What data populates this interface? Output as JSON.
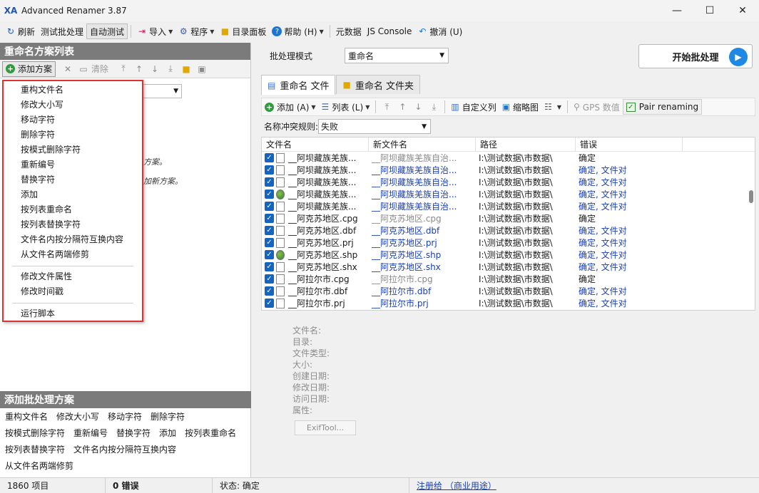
{
  "window": {
    "title": "Advanced Renamer 3.87",
    "app_icon_text": "XA"
  },
  "toolbar": {
    "refresh": "刷新",
    "test_batch": "测试批处理",
    "auto_test": "自动测试",
    "import": "导入",
    "program": "程序",
    "directory_panel": "目录面板",
    "help": "帮助 (H)",
    "metadata": "元数据",
    "js_console": "JS Console",
    "undo": "撤消 (U)"
  },
  "left": {
    "methods_header": "重命名方案列表",
    "add_method": "添加方案",
    "clear": "清除",
    "hint1": "方案。",
    "hint2": "加新方案。",
    "popup_group1": [
      "重构文件名",
      "修改大小写",
      "移动字符",
      "删除字符",
      "按模式删除字符",
      "重新编号",
      "替换字符",
      "添加",
      "按列表重命名",
      "按列表替换字符",
      "文件名内按分隔符互换内容",
      "从文件名两端修剪"
    ],
    "popup_group2": [
      "修改文件属性",
      "修改时间戳"
    ],
    "popup_group3": [
      "运行脚本"
    ],
    "add_header": "添加批处理方案",
    "quick_rows": [
      [
        "重构文件名",
        "修改大小写",
        "移动字符",
        "删除字符"
      ],
      [
        "按模式删除字符",
        "重新编号",
        "替换字符",
        "添加",
        "按列表重命名"
      ],
      [
        "按列表替换字符",
        "文件名内按分隔符互换内容"
      ],
      [
        "从文件名两端修剪"
      ]
    ]
  },
  "right": {
    "batch_mode_label": "批处理模式",
    "batch_mode_value": "重命名",
    "start_button": "开始批处理",
    "tabs": [
      "重命名 文件",
      "重命名 文件夹"
    ],
    "file_toolbar": {
      "add": "添加 (A)",
      "list": "列表 (L)",
      "custom_columns": "自定义列",
      "thumbnails": "缩略图",
      "gps": "GPS 数值",
      "pair_renaming": "Pair renaming"
    },
    "conflict_label": "名称冲突规则:",
    "conflict_value": "失败",
    "columns": [
      "文件名",
      "新文件名",
      "路径",
      "错误"
    ],
    "rows": [
      {
        "name": "__阿坝藏族羌族...",
        "new": "__阿坝藏族羌族自治...",
        "path": "I:\\测试数据\\市数据\\",
        "err": "确定",
        "icon": "file",
        "new_style": "gray",
        "err_style": "plain"
      },
      {
        "name": "__阿坝藏族羌族...",
        "new": "__阿坝藏族羌族自治...",
        "path": "I:\\测试数据\\市数据\\",
        "err": "确定, 文件对",
        "icon": "file",
        "new_style": "blue",
        "err_style": "blue"
      },
      {
        "name": "__阿坝藏族羌族...",
        "new": "__阿坝藏族羌族自治...",
        "path": "I:\\测试数据\\市数据\\",
        "err": "确定, 文件对",
        "icon": "file",
        "new_style": "blue",
        "err_style": "blue"
      },
      {
        "name": "__阿坝藏族羌族...",
        "new": "__阿坝藏族羌族自治...",
        "path": "I:\\测试数据\\市数据\\",
        "err": "确定, 文件对",
        "icon": "shape",
        "new_style": "blue",
        "err_style": "blue"
      },
      {
        "name": "__阿坝藏族羌族...",
        "new": "__阿坝藏族羌族自治...",
        "path": "I:\\测试数据\\市数据\\",
        "err": "确定, 文件对",
        "icon": "file",
        "new_style": "blue",
        "err_style": "blue"
      },
      {
        "name": "__阿克苏地区.cpg",
        "new": "__阿克苏地区.cpg",
        "path": "I:\\测试数据\\市数据\\",
        "err": "确定",
        "icon": "file",
        "new_style": "gray",
        "err_style": "plain"
      },
      {
        "name": "__阿克苏地区.dbf",
        "new": "__阿克苏地区.dbf",
        "path": "I:\\测试数据\\市数据\\",
        "err": "确定, 文件对",
        "icon": "file",
        "new_style": "blue",
        "err_style": "blue"
      },
      {
        "name": "__阿克苏地区.prj",
        "new": "__阿克苏地区.prj",
        "path": "I:\\测试数据\\市数据\\",
        "err": "确定, 文件对",
        "icon": "file",
        "new_style": "blue",
        "err_style": "blue"
      },
      {
        "name": "__阿克苏地区.shp",
        "new": "__阿克苏地区.shp",
        "path": "I:\\测试数据\\市数据\\",
        "err": "确定, 文件对",
        "icon": "shape",
        "new_style": "blue",
        "err_style": "blue"
      },
      {
        "name": "__阿克苏地区.shx",
        "new": "__阿克苏地区.shx",
        "path": "I:\\测试数据\\市数据\\",
        "err": "确定, 文件对",
        "icon": "file",
        "new_style": "blue",
        "err_style": "blue"
      },
      {
        "name": "__阿拉尔市.cpg",
        "new": "__阿拉尔市.cpg",
        "path": "I:\\测试数据\\市数据\\",
        "err": "确定",
        "icon": "file",
        "new_style": "gray",
        "err_style": "plain"
      },
      {
        "name": "__阿拉尔市.dbf",
        "new": "__阿拉尔市.dbf",
        "path": "I:\\测试数据\\市数据\\",
        "err": "确定, 文件对",
        "icon": "file",
        "new_style": "blue",
        "err_style": "blue"
      },
      {
        "name": "__阿拉尔市.prj",
        "new": "__阿拉尔市.prj",
        "path": "I:\\测试数据\\市数据\\",
        "err": "确定, 文件对",
        "icon": "file",
        "new_style": "blue",
        "err_style": "blue"
      }
    ],
    "info_labels": [
      "文件名:",
      "目录:",
      "文件类型:",
      "大小:",
      "创建日期:",
      "修改日期:",
      "访问日期:",
      "属性:"
    ],
    "exif_button": "ExifTool..."
  },
  "statusbar": {
    "items": "1860 项目",
    "errors": "0 错误",
    "status": "状态: 确定",
    "register": "注册给 （商业用途）"
  },
  "colors": {
    "accent": "#1e88e5",
    "header_gray": "#7b7b7b",
    "popup_border": "#e03030",
    "check_blue": "#1565c0",
    "link_blue": "#1a3fb0"
  }
}
